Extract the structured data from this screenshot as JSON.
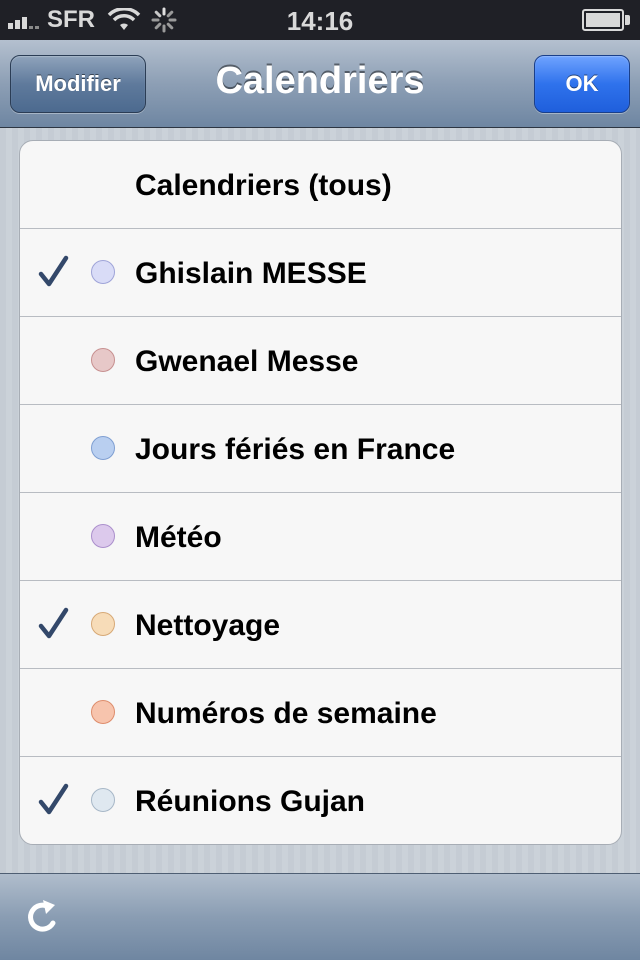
{
  "status_bar": {
    "carrier": "SFR",
    "time": "14:16",
    "icons": [
      "signal-icon",
      "wifi-icon",
      "activity-spinner-icon",
      "battery-icon"
    ]
  },
  "nav": {
    "title": "Calendriers",
    "left_button": "Modifier",
    "right_button": "OK"
  },
  "calendars": {
    "items": [
      {
        "label": "Calendriers (tous)",
        "checked": false,
        "color": null
      },
      {
        "label": "Ghislain MESSE",
        "checked": true,
        "color": "#d9dcf7",
        "border": "#9fa4d8"
      },
      {
        "label": "Gwenael Messe",
        "checked": false,
        "color": "#e7c8c8",
        "border": "#c79090"
      },
      {
        "label": "Jours fériés en France",
        "checked": false,
        "color": "#b9cff0",
        "border": "#7f9fd2"
      },
      {
        "label": "Météo",
        "checked": false,
        "color": "#dcc9ec",
        "border": "#ab8fcc"
      },
      {
        "label": "Nettoyage",
        "checked": true,
        "color": "#f7dcb8",
        "border": "#d7a976"
      },
      {
        "label": "Numéros de semaine",
        "checked": false,
        "color": "#f7c4ad",
        "border": "#de8d6c"
      },
      {
        "label": "Réunions Gujan",
        "checked": true,
        "color": "#dfe8f0",
        "border": "#a7b7c7"
      }
    ]
  },
  "toolbar": {
    "refresh_icon": "refresh-icon"
  },
  "colors": {
    "checkmark": "#33486a",
    "ok_button": "#2f72ec",
    "nav_bar": "#8d9fb5"
  }
}
